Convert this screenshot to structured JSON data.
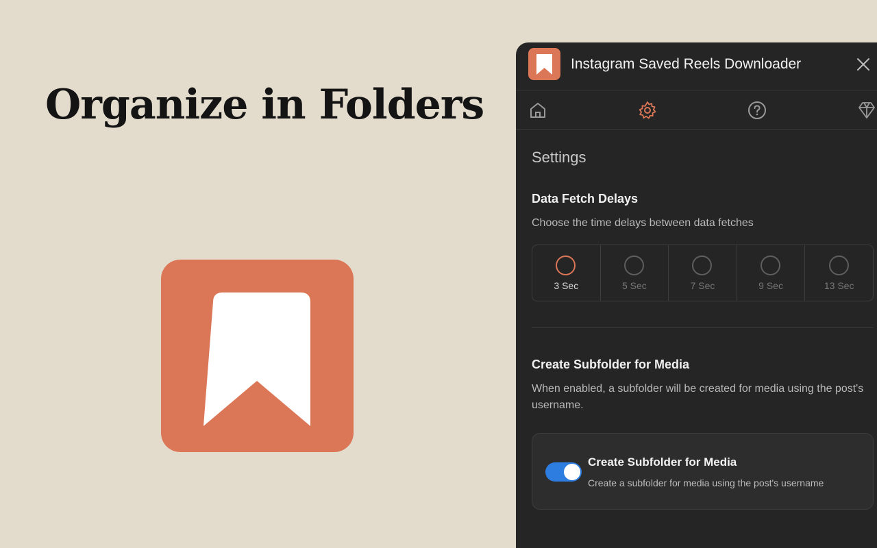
{
  "headline": "Organize in Folders",
  "app": {
    "title": "Instagram Saved Reels Downloader",
    "accent_color": "#db7757"
  },
  "nav": {
    "items": [
      {
        "icon": "home-icon",
        "active": false
      },
      {
        "icon": "gear-icon",
        "active": true
      },
      {
        "icon": "help-icon",
        "active": false
      },
      {
        "icon": "diamond-icon",
        "active": false
      }
    ]
  },
  "settings": {
    "title": "Settings",
    "fetch_delays": {
      "heading": "Data Fetch Delays",
      "description": "Choose the time delays between data fetches",
      "options": [
        "3 Sec",
        "5 Sec",
        "7 Sec",
        "9 Sec",
        "13 Sec"
      ],
      "selected": "3 Sec"
    },
    "subfolder": {
      "heading": "Create Subfolder for Media",
      "description": "When enabled, a subfolder will be created for media using the post's username.",
      "toggle_title": "Create Subfolder for Media",
      "toggle_description": "Create a subfolder for media using the post's username",
      "enabled": true,
      "toggle_color": "#2d7de0"
    }
  }
}
